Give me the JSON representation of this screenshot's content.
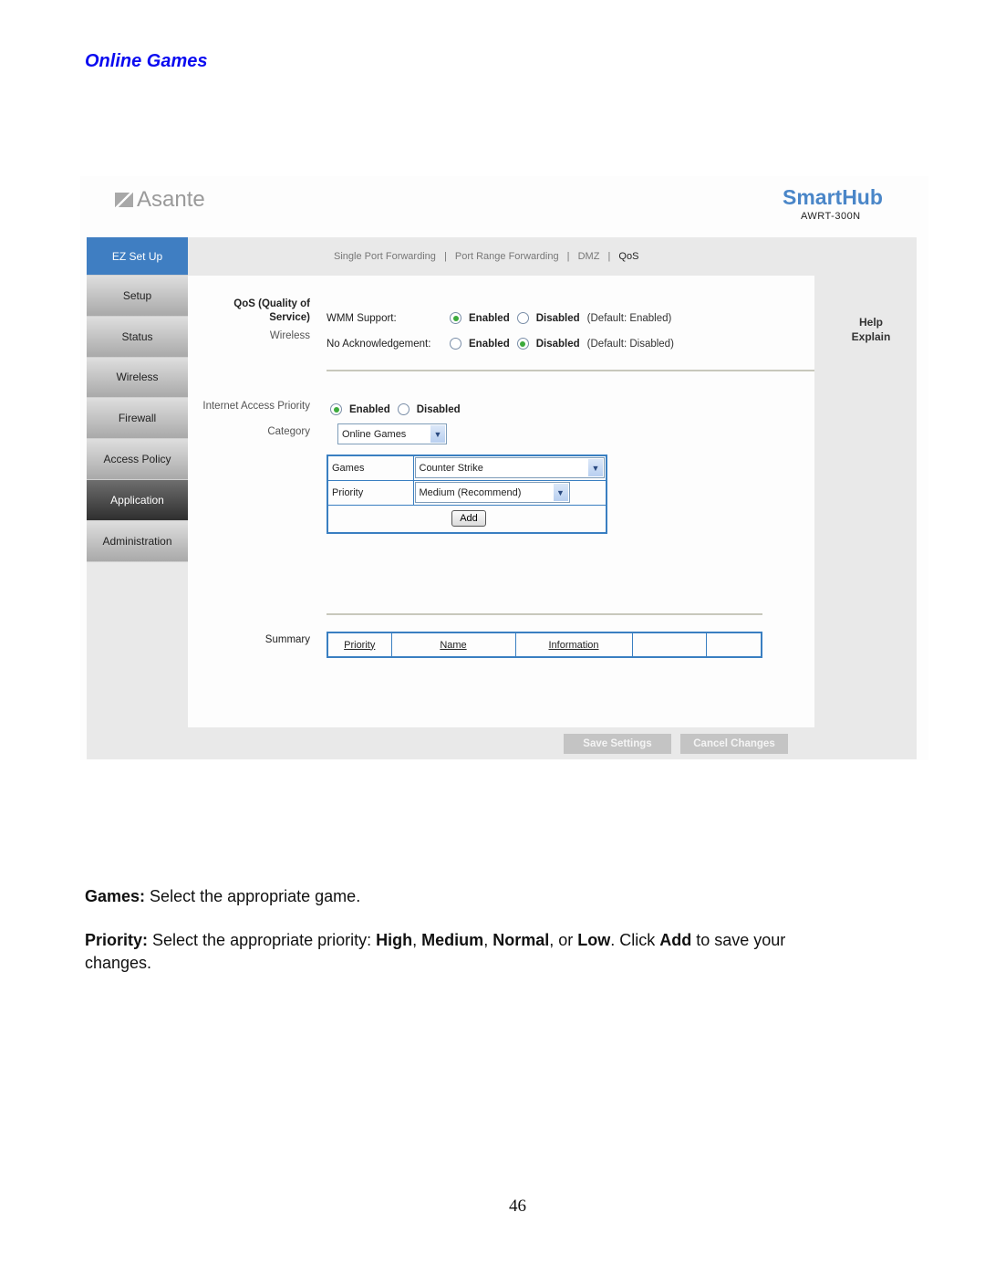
{
  "section_title": "Online Games",
  "screenshot": {
    "brand": "Asante",
    "product": "SmartHub",
    "model": "AWRT-300N",
    "sidebar": {
      "items": [
        {
          "label": "EZ Set Up",
          "state": "highlight"
        },
        {
          "label": "Setup"
        },
        {
          "label": "Status"
        },
        {
          "label": "Wireless"
        },
        {
          "label": "Firewall"
        },
        {
          "label": "Access Policy"
        },
        {
          "label": "Application",
          "state": "active"
        },
        {
          "label": "Administration"
        }
      ]
    },
    "subnav": {
      "items": [
        "Single Port Forwarding",
        "Port Range Forwarding",
        "DMZ",
        "QoS"
      ],
      "separator": "|",
      "current": "QoS"
    },
    "help": {
      "line1": "Help",
      "line2": "Explain"
    },
    "qos": {
      "section_label": "QoS (Quality of Service)",
      "section_label_line1": "QoS (Quality of",
      "section_label_line2": "Service)",
      "subsection_label": "Wireless",
      "wmm": {
        "label": "WMM Support:",
        "enabled": "Enabled",
        "disabled": "Disabled",
        "selected": "Enabled",
        "note": "(Default: Enabled)"
      },
      "no_ack": {
        "label": "No Acknowledgement:",
        "enabled": "Enabled",
        "disabled": "Disabled",
        "selected": "Disabled",
        "note": "(Default: Disabled)"
      }
    },
    "internet_access_priority": {
      "label": "Internet Access Priority",
      "enabled": "Enabled",
      "disabled": "Disabled",
      "selected": "Enabled"
    },
    "category": {
      "label": "Category",
      "value": "Online Games"
    },
    "games": {
      "label": "Games",
      "value": "Counter Strike"
    },
    "priority": {
      "label": "Priority",
      "value": "Medium (Recommend)"
    },
    "add_label": "Add",
    "summary": {
      "label": "Summary",
      "columns": [
        "Priority",
        "Name",
        "Information",
        "",
        ""
      ]
    },
    "save_label": "Save Settings",
    "cancel_label": "Cancel Changes"
  },
  "body_text": {
    "games_term": "Games:",
    "games_desc": " Select the appropriate game.",
    "priority_term": "Priority:",
    "priority_desc": " Select the appropriate priority: ",
    "opt_high": "High",
    "opt_medium": "Medium",
    "opt_normal": "Normal",
    "opt_low": "Low",
    "click": ". Click ",
    "add": "Add",
    "tail": " to save your changes."
  },
  "page_number": "46"
}
